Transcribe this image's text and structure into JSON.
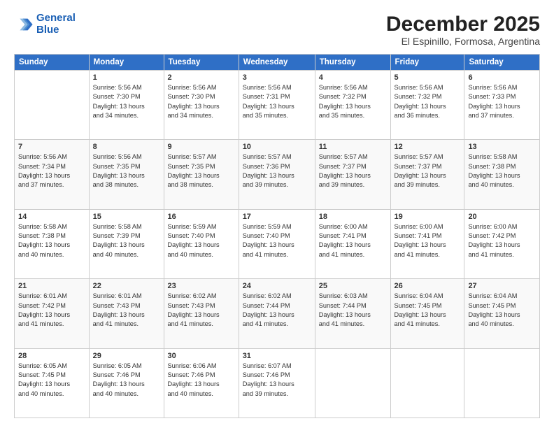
{
  "logo": {
    "line1": "General",
    "line2": "Blue"
  },
  "title": "December 2025",
  "subtitle": "El Espinillo, Formosa, Argentina",
  "days_header": [
    "Sunday",
    "Monday",
    "Tuesday",
    "Wednesday",
    "Thursday",
    "Friday",
    "Saturday"
  ],
  "weeks": [
    [
      {
        "day": "",
        "text": ""
      },
      {
        "day": "1",
        "text": "Sunrise: 5:56 AM\nSunset: 7:30 PM\nDaylight: 13 hours\nand 34 minutes."
      },
      {
        "day": "2",
        "text": "Sunrise: 5:56 AM\nSunset: 7:30 PM\nDaylight: 13 hours\nand 34 minutes."
      },
      {
        "day": "3",
        "text": "Sunrise: 5:56 AM\nSunset: 7:31 PM\nDaylight: 13 hours\nand 35 minutes."
      },
      {
        "day": "4",
        "text": "Sunrise: 5:56 AM\nSunset: 7:32 PM\nDaylight: 13 hours\nand 35 minutes."
      },
      {
        "day": "5",
        "text": "Sunrise: 5:56 AM\nSunset: 7:32 PM\nDaylight: 13 hours\nand 36 minutes."
      },
      {
        "day": "6",
        "text": "Sunrise: 5:56 AM\nSunset: 7:33 PM\nDaylight: 13 hours\nand 37 minutes."
      }
    ],
    [
      {
        "day": "7",
        "text": "Sunrise: 5:56 AM\nSunset: 7:34 PM\nDaylight: 13 hours\nand 37 minutes."
      },
      {
        "day": "8",
        "text": "Sunrise: 5:56 AM\nSunset: 7:35 PM\nDaylight: 13 hours\nand 38 minutes."
      },
      {
        "day": "9",
        "text": "Sunrise: 5:57 AM\nSunset: 7:35 PM\nDaylight: 13 hours\nand 38 minutes."
      },
      {
        "day": "10",
        "text": "Sunrise: 5:57 AM\nSunset: 7:36 PM\nDaylight: 13 hours\nand 39 minutes."
      },
      {
        "day": "11",
        "text": "Sunrise: 5:57 AM\nSunset: 7:37 PM\nDaylight: 13 hours\nand 39 minutes."
      },
      {
        "day": "12",
        "text": "Sunrise: 5:57 AM\nSunset: 7:37 PM\nDaylight: 13 hours\nand 39 minutes."
      },
      {
        "day": "13",
        "text": "Sunrise: 5:58 AM\nSunset: 7:38 PM\nDaylight: 13 hours\nand 40 minutes."
      }
    ],
    [
      {
        "day": "14",
        "text": "Sunrise: 5:58 AM\nSunset: 7:38 PM\nDaylight: 13 hours\nand 40 minutes."
      },
      {
        "day": "15",
        "text": "Sunrise: 5:58 AM\nSunset: 7:39 PM\nDaylight: 13 hours\nand 40 minutes."
      },
      {
        "day": "16",
        "text": "Sunrise: 5:59 AM\nSunset: 7:40 PM\nDaylight: 13 hours\nand 40 minutes."
      },
      {
        "day": "17",
        "text": "Sunrise: 5:59 AM\nSunset: 7:40 PM\nDaylight: 13 hours\nand 41 minutes."
      },
      {
        "day": "18",
        "text": "Sunrise: 6:00 AM\nSunset: 7:41 PM\nDaylight: 13 hours\nand 41 minutes."
      },
      {
        "day": "19",
        "text": "Sunrise: 6:00 AM\nSunset: 7:41 PM\nDaylight: 13 hours\nand 41 minutes."
      },
      {
        "day": "20",
        "text": "Sunrise: 6:00 AM\nSunset: 7:42 PM\nDaylight: 13 hours\nand 41 minutes."
      }
    ],
    [
      {
        "day": "21",
        "text": "Sunrise: 6:01 AM\nSunset: 7:42 PM\nDaylight: 13 hours\nand 41 minutes."
      },
      {
        "day": "22",
        "text": "Sunrise: 6:01 AM\nSunset: 7:43 PM\nDaylight: 13 hours\nand 41 minutes."
      },
      {
        "day": "23",
        "text": "Sunrise: 6:02 AM\nSunset: 7:43 PM\nDaylight: 13 hours\nand 41 minutes."
      },
      {
        "day": "24",
        "text": "Sunrise: 6:02 AM\nSunset: 7:44 PM\nDaylight: 13 hours\nand 41 minutes."
      },
      {
        "day": "25",
        "text": "Sunrise: 6:03 AM\nSunset: 7:44 PM\nDaylight: 13 hours\nand 41 minutes."
      },
      {
        "day": "26",
        "text": "Sunrise: 6:04 AM\nSunset: 7:45 PM\nDaylight: 13 hours\nand 41 minutes."
      },
      {
        "day": "27",
        "text": "Sunrise: 6:04 AM\nSunset: 7:45 PM\nDaylight: 13 hours\nand 40 minutes."
      }
    ],
    [
      {
        "day": "28",
        "text": "Sunrise: 6:05 AM\nSunset: 7:45 PM\nDaylight: 13 hours\nand 40 minutes."
      },
      {
        "day": "29",
        "text": "Sunrise: 6:05 AM\nSunset: 7:46 PM\nDaylight: 13 hours\nand 40 minutes."
      },
      {
        "day": "30",
        "text": "Sunrise: 6:06 AM\nSunset: 7:46 PM\nDaylight: 13 hours\nand 40 minutes."
      },
      {
        "day": "31",
        "text": "Sunrise: 6:07 AM\nSunset: 7:46 PM\nDaylight: 13 hours\nand 39 minutes."
      },
      {
        "day": "",
        "text": ""
      },
      {
        "day": "",
        "text": ""
      },
      {
        "day": "",
        "text": ""
      }
    ]
  ]
}
